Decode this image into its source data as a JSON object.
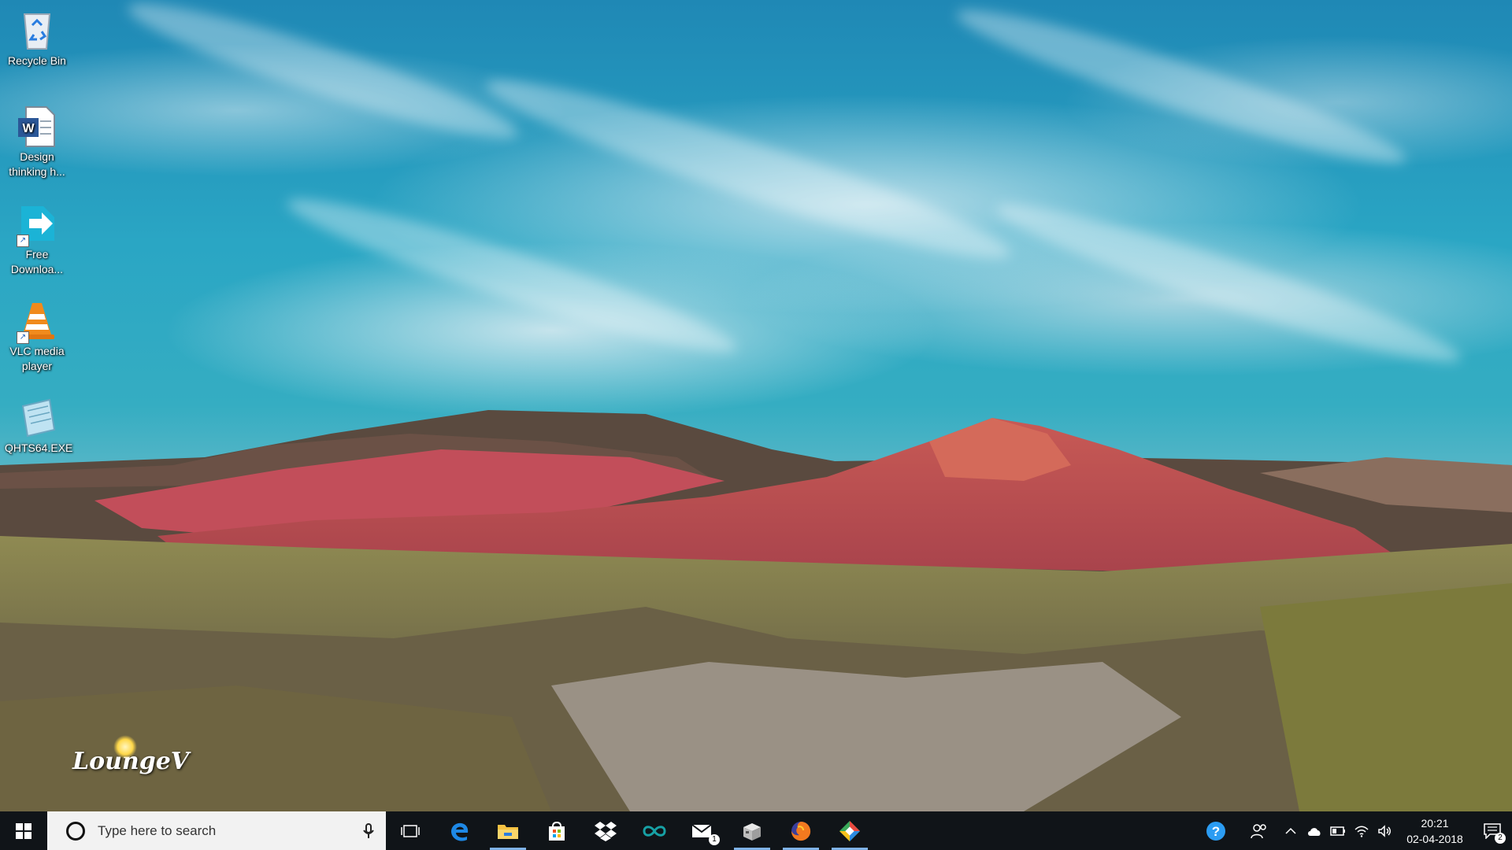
{
  "desktop": {
    "icons": [
      {
        "label": "Recycle Bin",
        "icon": "recycle-bin-icon"
      },
      {
        "label": "Design thinking h...",
        "icon": "word-document-icon"
      },
      {
        "label": "Free Downloa...",
        "icon": "free-download-manager-icon"
      },
      {
        "label": "VLC media player",
        "icon": "vlc-icon"
      },
      {
        "label": "QHTS64.EXE",
        "icon": "notepad-exe-icon"
      }
    ],
    "watermark": "LoungeV"
  },
  "taskbar": {
    "start_icon": "windows-logo-icon",
    "search": {
      "placeholder": "Type here to search",
      "icon": "cortana-circle-icon",
      "mic_icon": "microphone-icon"
    },
    "pinned": [
      {
        "name": "task-view",
        "icon": "task-view-icon",
        "active": false
      },
      {
        "name": "edge",
        "icon": "edge-icon",
        "active": false
      },
      {
        "name": "file-explorer",
        "icon": "folder-icon",
        "active": true
      },
      {
        "name": "store",
        "icon": "store-icon",
        "active": false
      },
      {
        "name": "dropbox",
        "icon": "dropbox-icon",
        "active": false
      },
      {
        "name": "arduino",
        "icon": "infinity-icon",
        "active": false
      },
      {
        "name": "mail",
        "icon": "mail-icon",
        "active": false,
        "badge": "1"
      },
      {
        "name": "app",
        "icon": "box-app-icon",
        "active": true
      },
      {
        "name": "firefox",
        "icon": "firefox-icon",
        "active": true
      },
      {
        "name": "colorful-app",
        "icon": "diamond-app-icon",
        "active": true
      }
    ],
    "tray": {
      "help_icon": "help-icon",
      "people_icon": "people-icon",
      "chevron_icon": "chevron-up-icon",
      "onedrive_icon": "cloud-icon",
      "battery_icon": "battery-icon",
      "wifi_icon": "wifi-icon",
      "volume_icon": "volume-icon",
      "time": "20:21",
      "date": "02-04-2018",
      "notification_count": "2"
    }
  },
  "colors": {
    "taskbar": "#101418",
    "active_indicator": "#7fb2e6",
    "sky": "#2aa6c4"
  }
}
